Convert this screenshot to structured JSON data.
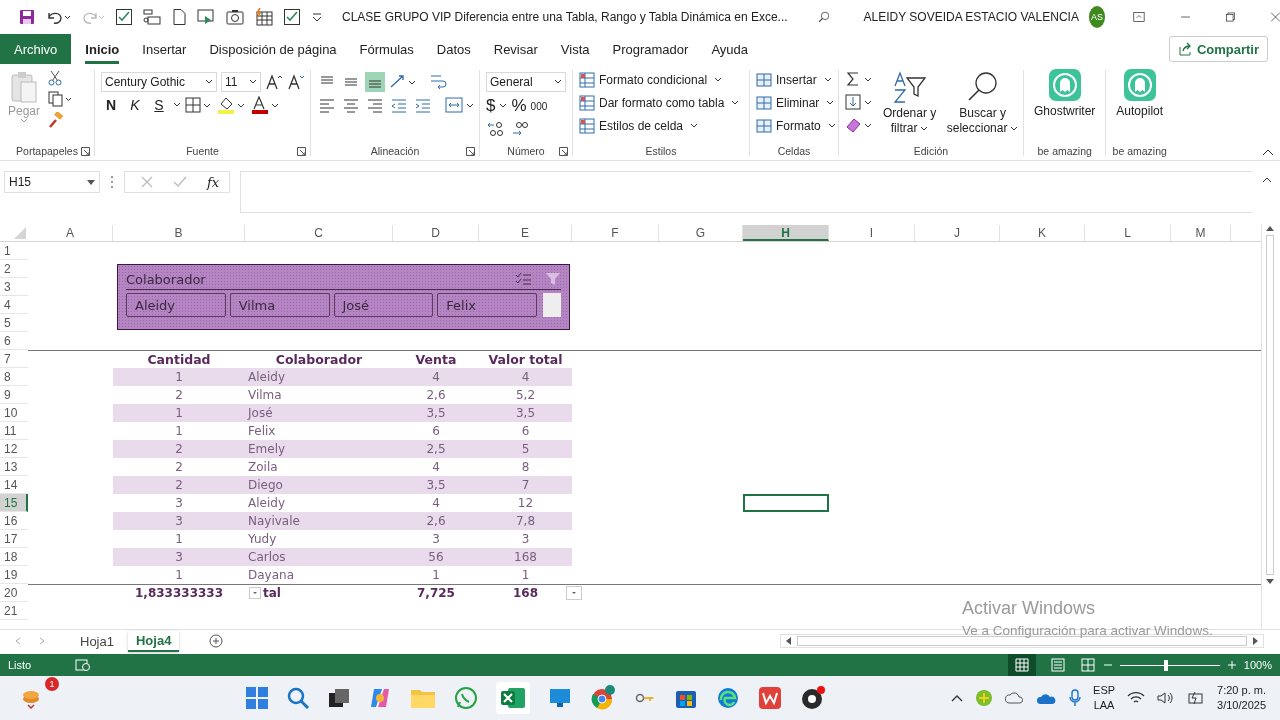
{
  "title_bar": {
    "title": "CLASE GRUPO VIP Diferencia entre una Tabla, Rango y Tabla Dinámica en Exce...",
    "user": "ALEIDY SOVEIDA ESTACIO VALENCIA",
    "avatar": "AS"
  },
  "ribbon_tabs": [
    {
      "label": "Archivo",
      "kind": "file",
      "selected": false
    },
    {
      "label": "Inicio",
      "kind": "tab",
      "selected": true
    },
    {
      "label": "Insertar",
      "kind": "tab",
      "selected": false
    },
    {
      "label": "Disposición de página",
      "kind": "tab",
      "selected": false
    },
    {
      "label": "Fórmulas",
      "kind": "tab",
      "selected": false
    },
    {
      "label": "Datos",
      "kind": "tab",
      "selected": false
    },
    {
      "label": "Revisar",
      "kind": "tab",
      "selected": false
    },
    {
      "label": "Vista",
      "kind": "tab",
      "selected": false
    },
    {
      "label": "Programador",
      "kind": "tab",
      "selected": false
    },
    {
      "label": "Ayuda",
      "kind": "tab",
      "selected": false
    }
  ],
  "share_button": "Compartir",
  "ribbon": {
    "clipboard": {
      "paste": "Pegar",
      "group": "Portapapeles"
    },
    "font": {
      "name": "Century Gothic",
      "size": "11",
      "bold": "N",
      "italic": "K",
      "underline": "S",
      "group": "Fuente"
    },
    "alignment": {
      "group": "Alineación",
      "vertical": [
        {
          "kind": "top",
          "selected": false
        },
        {
          "kind": "middle",
          "selected": false
        },
        {
          "kind": "bottom",
          "selected": true
        }
      ]
    },
    "number": {
      "format": "General",
      "currency": "$",
      "percent": "%",
      "thousands": "000",
      "group": "Número"
    },
    "styles": {
      "items": [
        "Formato condicional",
        "Dar formato como tabla",
        "Estilos de celda"
      ],
      "group": "Estilos"
    },
    "cells": {
      "items": [
        "Insertar",
        "Eliminar",
        "Formato"
      ],
      "group": "Celdas"
    },
    "editing": {
      "items": [
        "Ordenar y filtrar",
        "Buscar y seleccionar"
      ],
      "group": "Edición"
    },
    "addins": [
      {
        "name": "Ghostwriter",
        "group": "be amazing"
      },
      {
        "name": "Autopilot",
        "group": "be amazing"
      }
    ]
  },
  "formula_bar": {
    "name_box": "H15",
    "fx": "fx"
  },
  "sheet": {
    "columns": [
      {
        "label": "A",
        "selected": false
      },
      {
        "label": "B",
        "selected": false
      },
      {
        "label": "C",
        "selected": false
      },
      {
        "label": "D",
        "selected": false
      },
      {
        "label": "E",
        "selected": false
      },
      {
        "label": "F",
        "selected": false
      },
      {
        "label": "G",
        "selected": false
      },
      {
        "label": "H",
        "selected": true
      },
      {
        "label": "I",
        "selected": false
      },
      {
        "label": "J",
        "selected": false
      },
      {
        "label": "K",
        "selected": false
      },
      {
        "label": "L",
        "selected": false
      },
      {
        "label": "M",
        "selected": false
      }
    ],
    "rows": [
      {
        "label": "1",
        "selected": false
      },
      {
        "label": "2",
        "selected": false
      },
      {
        "label": "3",
        "selected": false
      },
      {
        "label": "4",
        "selected": false
      },
      {
        "label": "5",
        "selected": false
      },
      {
        "label": "6",
        "selected": false
      },
      {
        "label": "7",
        "selected": false
      },
      {
        "label": "8",
        "selected": false
      },
      {
        "label": "9",
        "selected": false
      },
      {
        "label": "10",
        "selected": false
      },
      {
        "label": "11",
        "selected": false
      },
      {
        "label": "12",
        "selected": false
      },
      {
        "label": "13",
        "selected": false
      },
      {
        "label": "14",
        "selected": false
      },
      {
        "label": "15",
        "selected": true
      },
      {
        "label": "16",
        "selected": false
      },
      {
        "label": "17",
        "selected": false
      },
      {
        "label": "18",
        "selected": false
      },
      {
        "label": "19",
        "selected": false
      },
      {
        "label": "20",
        "selected": false
      },
      {
        "label": "21",
        "selected": false
      }
    ]
  },
  "slicer": {
    "title": "Colaborador",
    "items": [
      "Aleidy",
      "Vilma",
      "José",
      "Felix"
    ]
  },
  "table": {
    "columns": [
      "Cantidad",
      "Colaborador",
      "Venta",
      "Valor total"
    ],
    "rows": [
      [
        "1",
        "Aleidy",
        "4",
        "4"
      ],
      [
        "2",
        "Vilma",
        "2,6",
        "5,2"
      ],
      [
        "1",
        "José",
        "3,5",
        "3,5"
      ],
      [
        "1",
        "Felix",
        "6",
        "6"
      ],
      [
        "2",
        "Emely",
        "2,5",
        "5"
      ],
      [
        "2",
        "Zoila",
        "4",
        "8"
      ],
      [
        "2",
        "Diego",
        "3,5",
        "7"
      ],
      [
        "3",
        "Aleidy",
        "4",
        "12"
      ],
      [
        "3",
        "Nayivale",
        "2,6",
        "7,8"
      ],
      [
        "1",
        "Yudy",
        "3",
        "3"
      ],
      [
        "3",
        "Carlos",
        "56",
        "168"
      ],
      [
        "1",
        "Dayana",
        "1",
        "1"
      ]
    ],
    "total": [
      "1,833333333",
      "tal",
      "7,725",
      "168"
    ]
  },
  "sheet_tabs": [
    {
      "label": "Hoja1",
      "selected": false
    },
    {
      "label": "Hoja4",
      "selected": true
    }
  ],
  "activation_notice": {
    "title": "Activar Windows",
    "message": "Ve a Configuración para activar Windows."
  },
  "status_bar": {
    "status": "Listo",
    "zoom": "100%",
    "zoom_slider": {
      "level": 0.46
    }
  },
  "taskbar": {
    "notification_count": "1",
    "language": "ESP",
    "layout": "LAA",
    "time": "7:20 p. m.",
    "date": "3/10/2025"
  }
}
